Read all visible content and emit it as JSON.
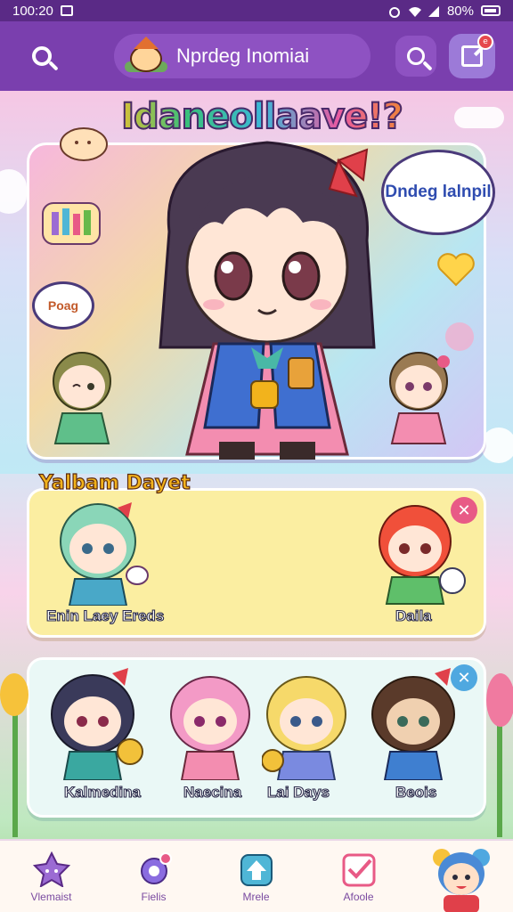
{
  "status": {
    "time": "100:20",
    "battery": "80%"
  },
  "header": {
    "app_title": "Nprdeg Inomiai"
  },
  "hero": {
    "title": "Idaneollaave!?",
    "bubble_right": "Dndeg lalnpil",
    "bubble_left": "Poag"
  },
  "favorites": {
    "title": "Yalbam Dayet",
    "chars": [
      {
        "label": "Enin Laey Ereds"
      },
      {
        "label": "Daila"
      }
    ]
  },
  "list": {
    "chars": [
      {
        "label": "Kalmedina"
      },
      {
        "label": "Naecina"
      },
      {
        "label": "Lai Days"
      },
      {
        "label": "Beois"
      }
    ]
  },
  "nav": {
    "items": [
      {
        "label": "Vlemaist",
        "color": "#9b6bd3"
      },
      {
        "label": "Fielis",
        "color": "#8a6ce0"
      },
      {
        "label": "Mrele",
        "color": "#4fb6d6"
      },
      {
        "label": "Afoole",
        "color": "#e85a86"
      }
    ]
  },
  "colors": {
    "header": "#7a3fae",
    "accent": "#e85a86",
    "close_blue": "#4fa8e0"
  }
}
